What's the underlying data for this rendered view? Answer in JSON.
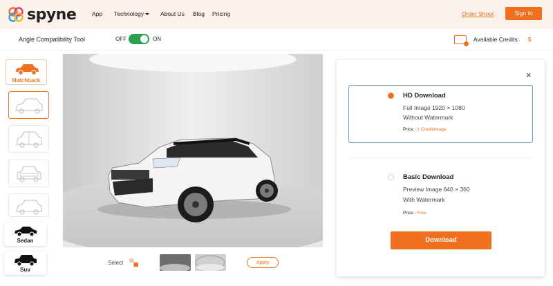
{
  "brand": {
    "name": "spyne"
  },
  "nav": {
    "items": [
      {
        "label": "App"
      },
      {
        "label": "Technology"
      },
      {
        "label": "About Us"
      },
      {
        "label": "Blog"
      },
      {
        "label": "Pricing"
      }
    ],
    "order_shoot": "Order Shoot",
    "sign_in": "Sign In"
  },
  "toolbar": {
    "title": "Angle Compatibility Tool",
    "toggle_off": "OFF",
    "toggle_on": "ON",
    "toggle_state": "on",
    "credits_label": "Available Credits:",
    "credits_value": "5"
  },
  "sidebar": {
    "selected_type": "Hatchback",
    "types": [
      {
        "label": "Sedan"
      },
      {
        "label": "Suv"
      }
    ],
    "angles": [
      "angle-1",
      "angle-2",
      "angle-3",
      "angle-4"
    ],
    "selected_angle": 0
  },
  "preview": {
    "select_label": "Select",
    "apply_label": "Apply"
  },
  "download_panel": {
    "close_symbol": "×",
    "options": [
      {
        "title": "HD Download",
        "line1": "Full Image 1920 × 1080",
        "line2": "Without Watermark",
        "price_label": "Price : ",
        "price_value": "1 Credit/image",
        "selected": true
      },
      {
        "title": "Basic Download",
        "line1": "Preview Image 640 × 360",
        "line2": "With Watermark",
        "price_label": "Price : ",
        "price_value": "Free",
        "selected": false
      }
    ],
    "button_label": "Download"
  },
  "colors": {
    "accent": "#f0701f",
    "toggle": "#2c9e4f",
    "nav_bg": "#fdf1eb",
    "selected_border": "#6a9bb8"
  }
}
